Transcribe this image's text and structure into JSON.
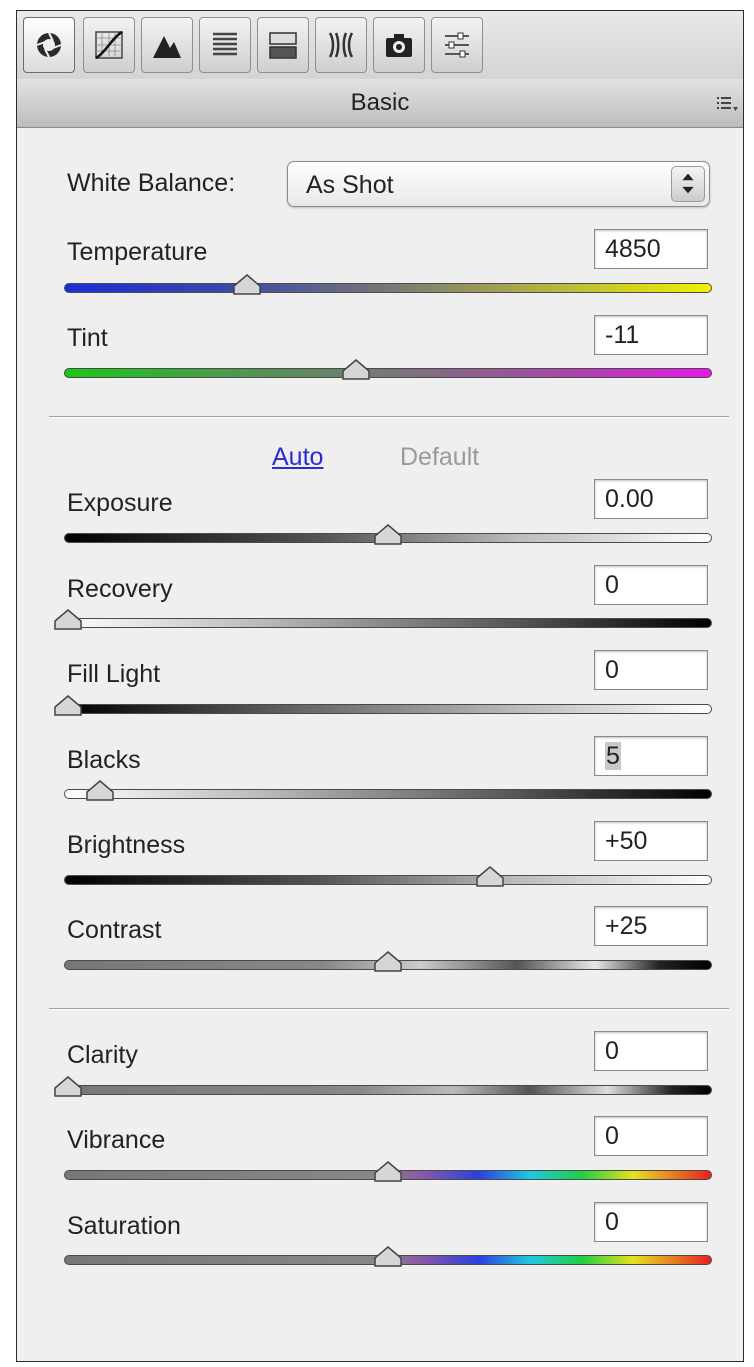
{
  "header": {
    "title": "Basic"
  },
  "tabs": [
    {
      "icon": "aperture-icon",
      "active": true
    },
    {
      "icon": "tone-curve-icon"
    },
    {
      "icon": "mountains-icon"
    },
    {
      "icon": "hsl-lines-icon"
    },
    {
      "icon": "split-toning-icon"
    },
    {
      "icon": "lens-corrections-icon"
    },
    {
      "icon": "camera-icon"
    },
    {
      "icon": "presets-sliders-icon"
    }
  ],
  "white_balance": {
    "label": "White Balance:",
    "value": "As Shot"
  },
  "temperature": {
    "label": "Temperature",
    "value": "4850",
    "position": 0.28
  },
  "tint": {
    "label": "Tint",
    "value": "-11",
    "position": 0.45
  },
  "tone": {
    "auto_label": "Auto",
    "default_label": "Default"
  },
  "exposure": {
    "label": "Exposure",
    "value": "0.00",
    "position": 0.5
  },
  "recovery": {
    "label": "Recovery",
    "value": "0",
    "position": 0.0
  },
  "fill_light": {
    "label": "Fill Light",
    "value": "0",
    "position": 0.0
  },
  "blacks": {
    "label": "Blacks",
    "value": "5",
    "position": 0.05
  },
  "brightness": {
    "label": "Brightness",
    "value": "+50",
    "position": 0.66
  },
  "contrast": {
    "label": "Contrast",
    "value": "+25",
    "position": 0.5
  },
  "clarity": {
    "label": "Clarity",
    "value": "0",
    "position": 0.0
  },
  "vibrance": {
    "label": "Vibrance",
    "value": "0",
    "position": 0.5
  },
  "saturation": {
    "label": "Saturation",
    "value": "0",
    "position": 0.5
  },
  "colors": {
    "link": "#2b2bd8",
    "disabled": "#9a9a9a"
  }
}
